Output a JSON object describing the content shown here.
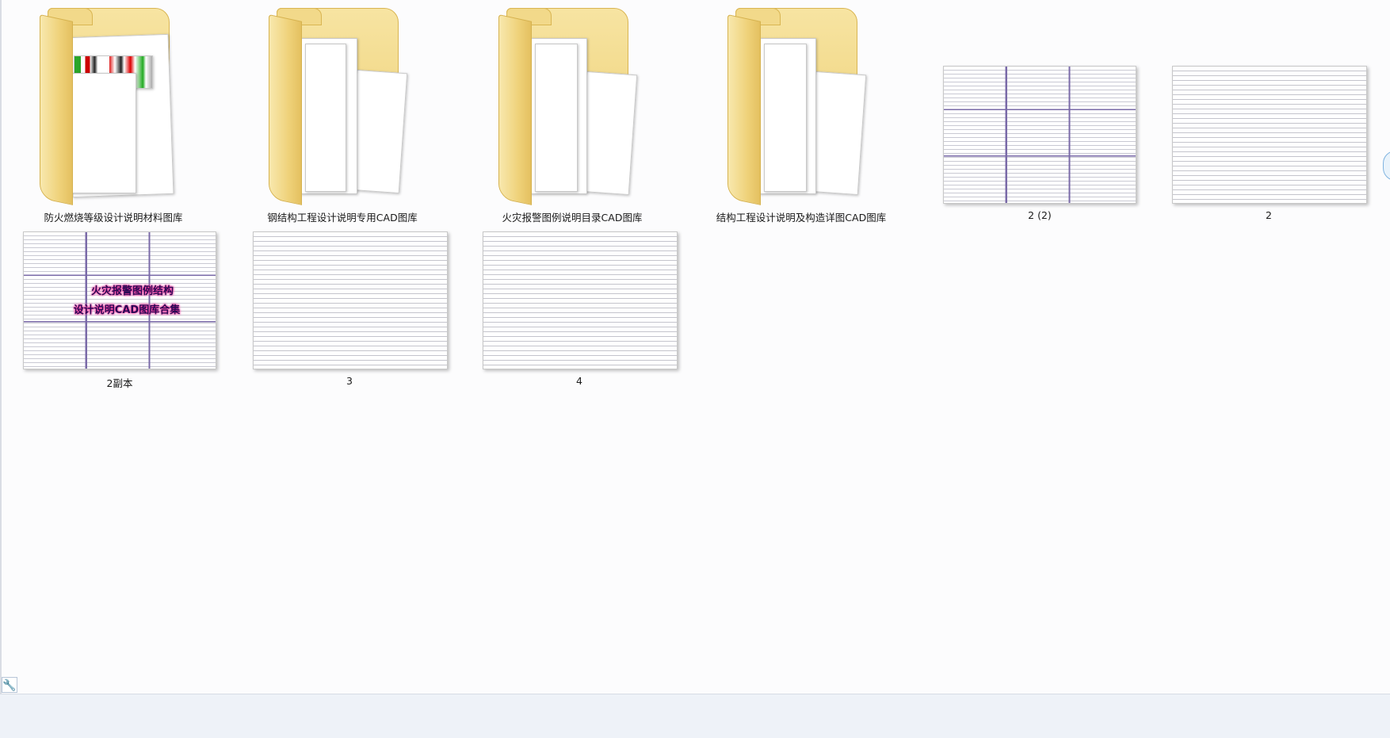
{
  "items": [
    {
      "name": "防火燃烧等级设计说明材料图库",
      "kind": "folder"
    },
    {
      "name": "钢结构工程设计说明专用CAD图库",
      "kind": "folder"
    },
    {
      "name": "火灾报警图例说明目录CAD图库",
      "kind": "folder"
    },
    {
      "name": "结构工程设计说明及构造详图CAD图库",
      "kind": "folder"
    },
    {
      "name": "2 (2)",
      "kind": "image"
    },
    {
      "name": "2",
      "kind": "image"
    },
    {
      "name": "2副本",
      "kind": "image",
      "overlay_line1": "火灾报警图例结构",
      "overlay_line2": "设计说明CAD图库合集"
    },
    {
      "name": "3",
      "kind": "image"
    },
    {
      "name": "4",
      "kind": "image"
    }
  ],
  "statusbar": {
    "tool_icon": "wrench-icon"
  },
  "colors": {
    "folder": "#eccd6e",
    "background": "#fcfcfd",
    "status": "#eef2f8"
  }
}
